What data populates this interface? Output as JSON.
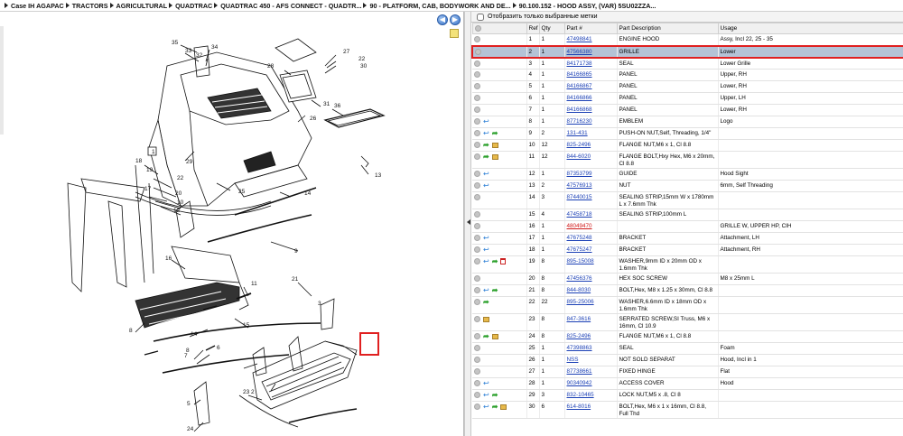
{
  "breadcrumb": [
    "Case IH AGAPAC",
    "TRACTORS",
    "AGRICULTURAL",
    "QUADTRAC",
    "QUADTRAC 450 - AFS CONNECT - QUADTR...",
    "90 - PLATFORM, CAB, BODYWORK AND DE...",
    "90.100.152 - HOOD ASSY, (VAR) 5SU02ZZA..."
  ],
  "filter": {
    "label": "Отобразить только выбранные метки",
    "checked": false
  },
  "table": {
    "headers": [
      "",
      "Ref",
      "Qty",
      "Part #",
      "Part Description",
      "Usage"
    ],
    "rows": [
      {
        "icons": [],
        "ref": "1",
        "qty": "1",
        "part": "47498841",
        "desc": "ENGINE HOOD",
        "usage": "Assy, Incl 22, 25 - 35"
      },
      {
        "icons": [],
        "ref": "2",
        "qty": "1",
        "part": "47566380",
        "desc": "GRILLE",
        "usage": "Lower",
        "selected": true
      },
      {
        "icons": [],
        "ref": "3",
        "qty": "1",
        "part": "84171738",
        "desc": "SEAL",
        "usage": "Lower Grille"
      },
      {
        "icons": [],
        "ref": "4",
        "qty": "1",
        "part": "84166865",
        "desc": "PANEL",
        "usage": "Upper, RH"
      },
      {
        "icons": [],
        "ref": "5",
        "qty": "1",
        "part": "84166867",
        "desc": "PANEL",
        "usage": "Lower, RH"
      },
      {
        "icons": [],
        "ref": "6",
        "qty": "1",
        "part": "84166866",
        "desc": "PANEL",
        "usage": "Upper, LH"
      },
      {
        "icons": [],
        "ref": "7",
        "qty": "1",
        "part": "84166868",
        "desc": "PANEL",
        "usage": "Lower, RH"
      },
      {
        "icons": [
          "return"
        ],
        "ref": "8",
        "qty": "1",
        "part": "87716230",
        "desc": "EMBLEM",
        "usage": "Logo"
      },
      {
        "icons": [
          "return",
          "arrow"
        ],
        "ref": "9",
        "qty": "2",
        "part": "131-431",
        "desc": "PUSH-ON NUT,Self, Threading, 1/4\"",
        "usage": ""
      },
      {
        "icons": [
          "arrow",
          "box"
        ],
        "ref": "10",
        "qty": "12",
        "part": "825-2496",
        "desc": "FLANGE NUT,M6 x 1, Cl 8.8",
        "usage": ""
      },
      {
        "icons": [
          "arrow",
          "box"
        ],
        "ref": "11",
        "qty": "12",
        "part": "844-6020",
        "desc": "FLANGE BOLT,Hxy Hex, M6 x 20mm, Cl 8.8",
        "usage": "",
        "tall": true
      },
      {
        "icons": [
          "return"
        ],
        "ref": "12",
        "qty": "1",
        "part": "87353799",
        "desc": "GUIDE",
        "usage": "Hood Sight"
      },
      {
        "icons": [
          "return"
        ],
        "ref": "13",
        "qty": "2",
        "part": "47576913",
        "desc": "NUT",
        "usage": "6mm, Self Threading"
      },
      {
        "icons": [],
        "ref": "14",
        "qty": "3",
        "part": "87440015",
        "desc": "SEALING STRIP,15mm W x 1780mm L x 7.6mm Thk",
        "usage": "",
        "tall": true
      },
      {
        "icons": [],
        "ref": "15",
        "qty": "4",
        "part": "47458718",
        "desc": "SEALING STRIP,100mm L",
        "usage": ""
      },
      {
        "icons": [],
        "ref": "16",
        "qty": "1",
        "part": "48049470",
        "desc": "",
        "usage": "GRILLE W, UPPER HP, CIH",
        "red": true
      },
      {
        "icons": [
          "return"
        ],
        "ref": "17",
        "qty": "1",
        "part": "47675248",
        "desc": "BRACKET",
        "usage": "Attachment, LH"
      },
      {
        "icons": [
          "return"
        ],
        "ref": "18",
        "qty": "1",
        "part": "47675247",
        "desc": "BRACKET",
        "usage": "Attachment, RH"
      },
      {
        "icons": [
          "return",
          "arrow",
          "doc"
        ],
        "ref": "19",
        "qty": "8",
        "part": "895-15008",
        "desc": "WASHER,9mm ID x 20mm OD x 1.6mm Thk",
        "usage": "",
        "tall": true
      },
      {
        "icons": [],
        "ref": "20",
        "qty": "8",
        "part": "47456376",
        "desc": "HEX SOC SCREW",
        "usage": "M8 x 25mm L"
      },
      {
        "icons": [
          "return",
          "arrow"
        ],
        "ref": "21",
        "qty": "8",
        "part": "844-8030",
        "desc": "BOLT,Hex, M8 x 1.25 x 30mm, Cl 8.8",
        "usage": ""
      },
      {
        "icons": [
          "arrow"
        ],
        "ref": "22",
        "qty": "22",
        "part": "895-25006",
        "desc": "WASHER,6.6mm ID x 18mm OD x 1.6mm Thk",
        "usage": "",
        "tall": true
      },
      {
        "icons": [
          "box"
        ],
        "ref": "23",
        "qty": "8",
        "part": "847-3616",
        "desc": "SERRATED SCREW,SI Truss, M6 x 16mm, Cl 10.9",
        "usage": "",
        "tall": true
      },
      {
        "icons": [
          "arrow",
          "box"
        ],
        "ref": "24",
        "qty": "8",
        "part": "825-2496",
        "desc": "FLANGE NUT,M6 x 1, Cl 8.8",
        "usage": ""
      },
      {
        "icons": [],
        "ref": "25",
        "qty": "1",
        "part": "47398863",
        "desc": "SEAL",
        "usage": "Foam"
      },
      {
        "icons": [],
        "ref": "26",
        "qty": "1",
        "part": "NSS",
        "desc": "NOT SOLD SEPARAT",
        "usage": "Hood, Incl in 1"
      },
      {
        "icons": [],
        "ref": "27",
        "qty": "1",
        "part": "87738661",
        "desc": "FIXED HINGE",
        "usage": "Flat"
      },
      {
        "icons": [
          "return"
        ],
        "ref": "28",
        "qty": "1",
        "part": "90340942",
        "desc": "ACCESS COVER",
        "usage": "Hood"
      },
      {
        "icons": [
          "return",
          "arrow"
        ],
        "ref": "29",
        "qty": "3",
        "part": "832-10465",
        "desc": "LOCK NUT,M5 x .8, Cl 8",
        "usage": ""
      },
      {
        "icons": [
          "return",
          "arrow",
          "box"
        ],
        "ref": "30",
        "qty": "6",
        "part": "614-8016",
        "desc": "BOLT,Hex, M6 x 1 x 16mm, Cl 8.8, Full Thd",
        "usage": "",
        "tall": true
      }
    ]
  },
  "diagram": {
    "callouts": [
      "35",
      "33",
      "34",
      "32",
      "30",
      "28",
      "27",
      "22",
      "36",
      "31",
      "26",
      "1",
      "29",
      "18",
      "19",
      "22",
      "17",
      "20",
      "10",
      "12",
      "13",
      "25",
      "14",
      "9",
      "16",
      "8",
      "11",
      "21",
      "14",
      "15",
      "7",
      "8",
      "6",
      "2",
      "23",
      "5",
      "24",
      "3"
    ]
  }
}
